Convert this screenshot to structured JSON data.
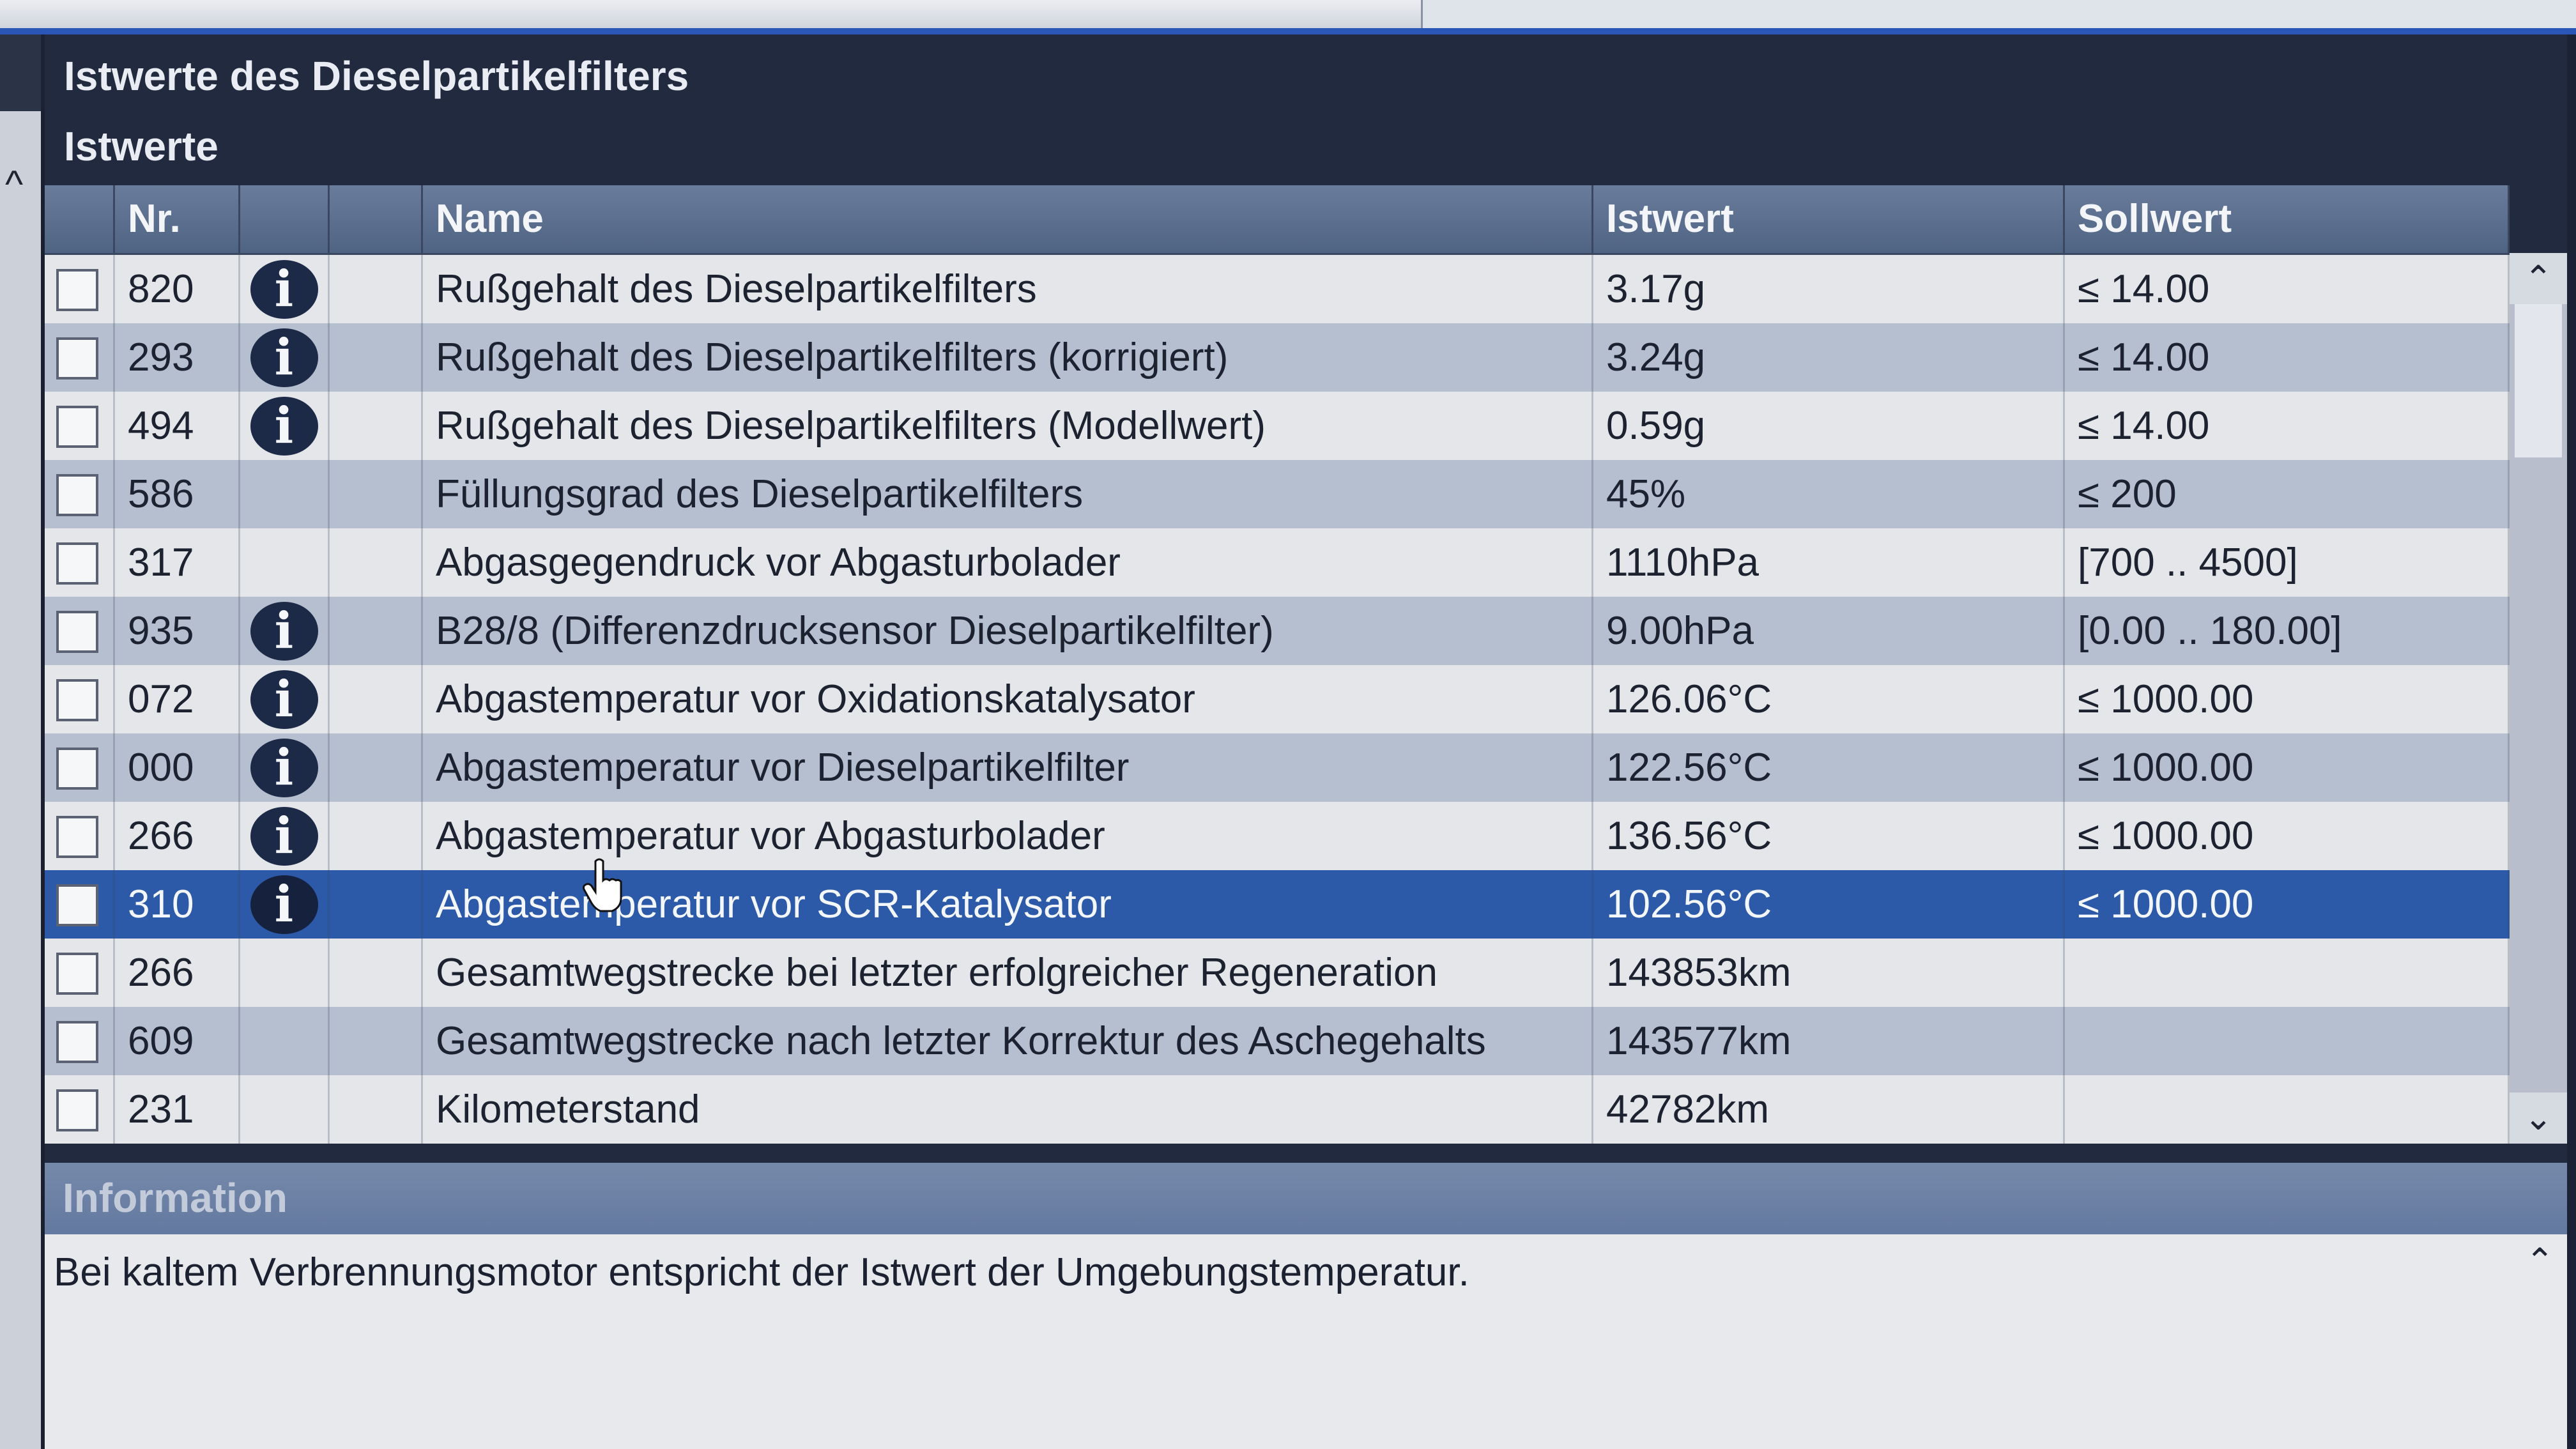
{
  "panel": {
    "title": "Istwerte des Dieselpartikelfilters",
    "section": "Istwerte"
  },
  "table": {
    "headers": {
      "nr": "Nr.",
      "name": "Name",
      "istwert": "Istwert",
      "sollwert": "Sollwert"
    },
    "rows": [
      {
        "nr": "820",
        "info": true,
        "name": "Rußgehalt des Dieselpartikelfilters",
        "ist": "3.17g",
        "soll": "≤ 14.00",
        "selected": false
      },
      {
        "nr": "293",
        "info": true,
        "name": "Rußgehalt des Dieselpartikelfilters (korrigiert)",
        "ist": "3.24g",
        "soll": "≤ 14.00",
        "selected": false
      },
      {
        "nr": "494",
        "info": true,
        "name": "Rußgehalt des Dieselpartikelfilters (Modellwert)",
        "ist": "0.59g",
        "soll": "≤ 14.00",
        "selected": false
      },
      {
        "nr": "586",
        "info": false,
        "name": "Füllungsgrad des Dieselpartikelfilters",
        "ist": "45%",
        "soll": "≤ 200",
        "selected": false
      },
      {
        "nr": "317",
        "info": false,
        "name": "Abgasgegendruck vor Abgasturbolader",
        "ist": "1110hPa",
        "soll": "[700 .. 4500]",
        "selected": false
      },
      {
        "nr": "935",
        "info": true,
        "name": "B28/8 (Differenzdrucksensor Dieselpartikelfilter)",
        "ist": "9.00hPa",
        "soll": "[0.00 .. 180.00]",
        "selected": false
      },
      {
        "nr": "072",
        "info": true,
        "name": "Abgastemperatur vor Oxidationskatalysator",
        "ist": "126.06°C",
        "soll": "≤ 1000.00",
        "selected": false
      },
      {
        "nr": "000",
        "info": true,
        "name": "Abgastemperatur vor Dieselpartikelfilter",
        "ist": "122.56°C",
        "soll": "≤ 1000.00",
        "selected": false
      },
      {
        "nr": "266",
        "info": true,
        "name": "Abgastemperatur vor Abgasturbolader",
        "ist": "136.56°C",
        "soll": "≤ 1000.00",
        "selected": false
      },
      {
        "nr": "310",
        "info": true,
        "name": "Abgastemperatur vor SCR-Katalysator",
        "ist": "102.56°C",
        "soll": "≤ 1000.00",
        "selected": true
      },
      {
        "nr": "266",
        "info": false,
        "name": "Gesamtwegstrecke bei letzter erfolgreicher Regeneration",
        "ist": "143853km",
        "soll": "",
        "selected": false
      },
      {
        "nr": "609",
        "info": false,
        "name": "Gesamtwegstrecke nach letzter Korrektur des Aschegehalts",
        "ist": "143577km",
        "soll": "",
        "selected": false
      },
      {
        "nr": "231",
        "info": false,
        "name": "Kilometerstand",
        "ist": "42782km",
        "soll": "",
        "selected": false
      }
    ]
  },
  "information": {
    "header": "Information",
    "text": "Bei kaltem Verbrennungsmotor entspricht der Istwert der Umgebungstemperatur."
  },
  "icons": {
    "info": "info-icon",
    "scroll_up": "chevron-up-icon",
    "scroll_down": "chevron-down-icon",
    "cursor": "hand-cursor-icon"
  },
  "colors": {
    "selected_row": "#2d5aa8",
    "header_gradient_top": "#6a7c9b",
    "panel_background": "#222a3f"
  }
}
